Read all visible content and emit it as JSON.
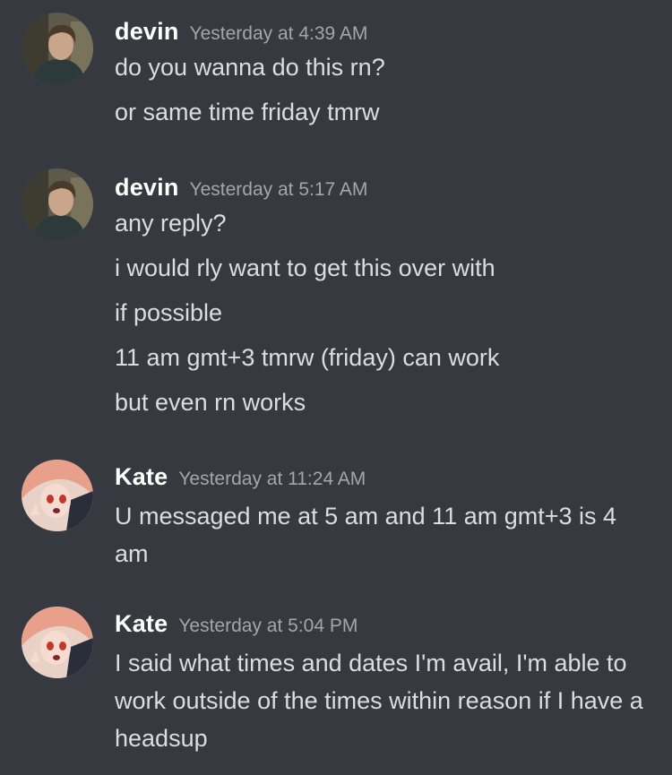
{
  "messages": [
    {
      "author": "devin",
      "timestamp": "Yesterday at 4:39 AM",
      "lines": [
        "do you wanna do this rn?",
        "or same time friday tmrw"
      ]
    },
    {
      "author": "devin",
      "timestamp": "Yesterday at 5:17 AM",
      "lines": [
        "any reply?",
        "i would rly want to get this over with",
        "if possible",
        "11 am gmt+3 tmrw (friday) can work",
        "but even rn works"
      ]
    },
    {
      "author": "Kate",
      "timestamp": "Yesterday at 11:24 AM",
      "lines": [
        "U messaged me at 5 am and 11 am gmt+3 is 4 am"
      ]
    },
    {
      "author": "Kate",
      "timestamp": "Yesterday at 5:04 PM",
      "lines": [
        "I said what times and dates I'm avail, I'm able to work outside of the times within reason if I have a headsup"
      ]
    }
  ],
  "colors": {
    "background": "#36393f",
    "username": "#ffffff",
    "timestamp": "#a3a6aa",
    "text": "#dcddde"
  }
}
